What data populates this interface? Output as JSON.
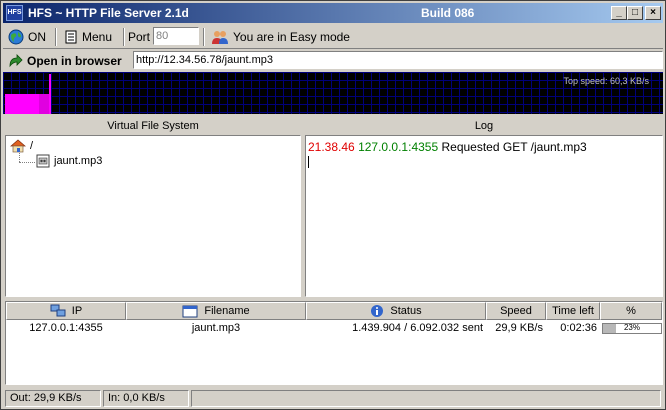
{
  "window": {
    "app_icon": "HFS",
    "title": "HFS ~ HTTP File Server 2.1d",
    "build": "Build 086",
    "minimize": "_",
    "maximize": "□",
    "close": "×"
  },
  "toolbar": {
    "on_label": "ON",
    "menu_label": "Menu",
    "port_label": "Port",
    "port_value": "80",
    "mode_label": "You are in Easy mode"
  },
  "urlbar": {
    "open_label": "Open in browser",
    "url": "http://12.34.56.78/jaunt.mp3"
  },
  "graph": {
    "top_speed": "Top speed: 60,3 KB/s",
    "bar_fill_color": "#ff00ff",
    "grid_color": "#00007a"
  },
  "vfs": {
    "header": "Virtual File System",
    "root": "/",
    "items": [
      "jaunt.mp3"
    ]
  },
  "log": {
    "header": "Log",
    "entries": [
      {
        "time": "21.38.46",
        "ip": "127.0.0.1:4355",
        "message": "Requested GET /jaunt.mp3"
      }
    ]
  },
  "connections": {
    "columns": {
      "ip": "IP",
      "filename": "Filename",
      "status": "Status",
      "speed": "Speed",
      "time_left": "Time left",
      "percent": "%"
    },
    "rows": [
      {
        "ip": "127.0.0.1:4355",
        "filename": "jaunt.mp3",
        "status": "1.439.904 / 6.092.032 sent",
        "speed": "29,9 KB/s",
        "time_left": "0:02:36",
        "percent": "23%",
        "progress": 0.23
      }
    ]
  },
  "statusbar": {
    "out": "Out: 29,9 KB/s",
    "in": "In: 0,0 KB/s"
  }
}
